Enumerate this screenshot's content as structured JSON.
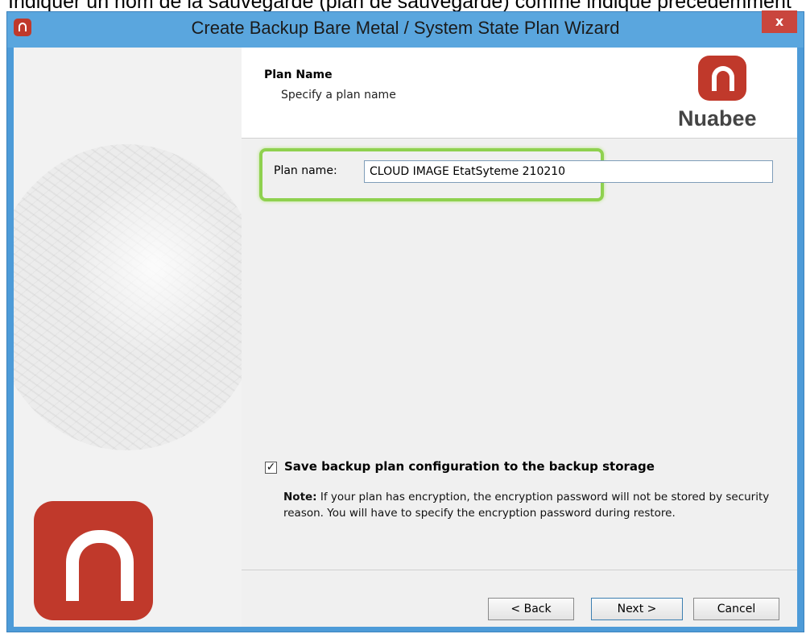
{
  "caption": "Indiquer un nom de la sauvegarde (plan de sauvegarde) comme indiqué précédemment",
  "window": {
    "title": "Create Backup Bare Metal / System State Plan Wizard",
    "close_label": "x"
  },
  "header": {
    "title": "Plan Name",
    "subtitle": "Specify a plan name",
    "brand": "Nuabee"
  },
  "form": {
    "plan_name_label": "Plan name:",
    "plan_name_value": "CLOUD IMAGE EtatSyteme 210210",
    "save_config_checked": true,
    "save_config_label": "Save backup plan configuration to the backup storage",
    "note_label": "Note:",
    "note_text": " If your plan has encryption, the encryption password will not be stored by security reason. You will have to specify the encryption password during restore."
  },
  "buttons": {
    "back": "< Back",
    "next": "Next >",
    "cancel": "Cancel"
  },
  "colors": {
    "brand_red": "#c0392b",
    "highlight_green": "#8fd14f",
    "titlebar_blue": "#5aa6de"
  }
}
